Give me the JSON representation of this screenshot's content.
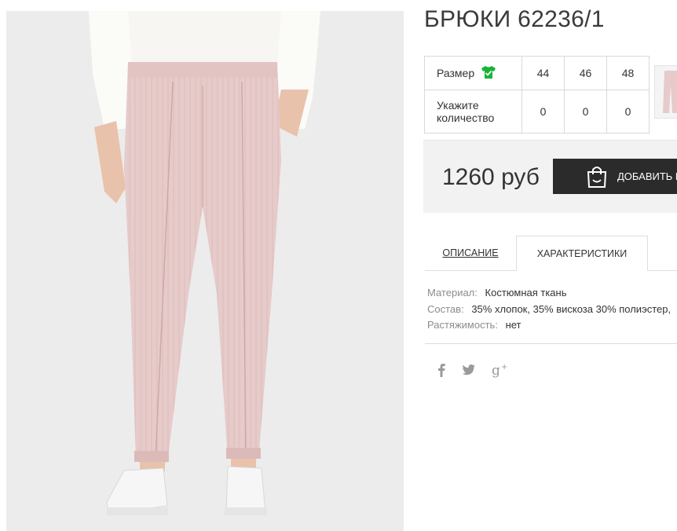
{
  "product": {
    "title": "БРЮКИ 62236/1",
    "image_alt": "pink-striped-trousers-photo"
  },
  "size_table": {
    "size_label": "Размер",
    "size_icon": "tshirt-check-icon",
    "sizes": [
      "44",
      "46",
      "48"
    ],
    "quantity_label": "Укажите количество",
    "quantities": [
      "0",
      "0",
      "0"
    ]
  },
  "pricing": {
    "price": "1260 руб",
    "add_to_cart_label": "ДОБАВИТЬ В"
  },
  "tabs": {
    "description": "ОПИСАНИЕ",
    "characteristics": "ХАРАКТЕРИСТИКИ"
  },
  "characteristics": [
    {
      "key": "Материал:",
      "value": "Костюмная ткань"
    },
    {
      "key": "Состав:",
      "value": "35% хлопок, 35% вискоза 30% полиэстер,"
    },
    {
      "key": "Растяжимость:",
      "value": "нет"
    }
  ],
  "social": [
    "facebook-icon",
    "twitter-icon",
    "google-plus-icon"
  ],
  "colors": {
    "accent_green": "#19b33a",
    "button_dark": "#2b2b2b",
    "trousers_pink": "#e8cdcb"
  }
}
